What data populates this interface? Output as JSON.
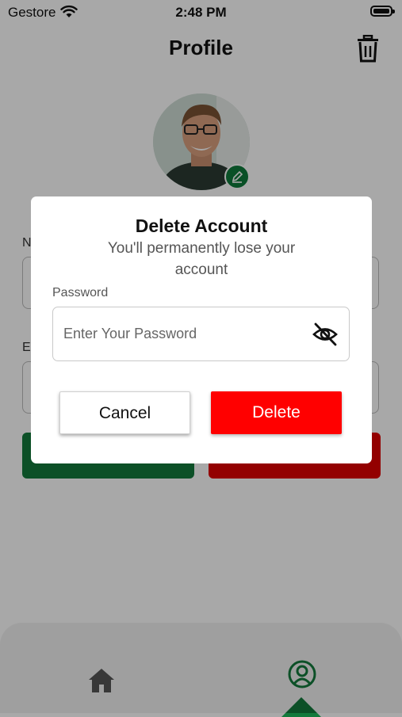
{
  "status_bar": {
    "carrier": "Gestore",
    "time": "2:48 PM"
  },
  "header": {
    "title": "Profile",
    "delete_icon": "trash-icon"
  },
  "profile": {
    "avatar_icon": "avatar-photo",
    "edit_icon": "pencil-icon",
    "name_label_partial": "N",
    "email_label_partial": "E"
  },
  "dialog": {
    "title": "Delete Account",
    "subtitle": "You'll permanently lose your account",
    "password_label": "Password",
    "password_placeholder": "Enter Your Password",
    "visibility_icon": "eye-off-icon",
    "cancel_label": "Cancel",
    "delete_label": "Delete"
  },
  "tabbar": {
    "items": [
      {
        "icon": "home-icon"
      },
      {
        "icon": "user-circle-icon",
        "active": true
      }
    ]
  },
  "colors": {
    "primary_green": "#137a3c",
    "danger_red": "#ff0000",
    "overlay": "rgba(0,0,0,0.34)"
  }
}
